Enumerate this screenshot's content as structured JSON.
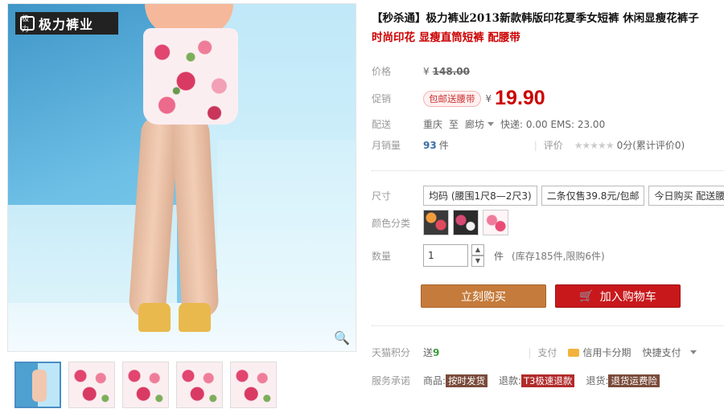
{
  "brand": {
    "logo_mark": "极力",
    "logo_text": "极力裤业"
  },
  "product": {
    "title": "【秒杀通】极力裤业2013新款韩版印花夏季女短裤 休闲显瘦花裤子",
    "subtitle": "时尚印花 显瘦直筒短裤 配腰带"
  },
  "price": {
    "label": "价格",
    "currency": "¥",
    "original": "148.00",
    "promo_label": "促销",
    "promo_badge": "包邮送腰带",
    "promo_price": "19.90"
  },
  "shipping": {
    "label": "配送",
    "from": "重庆",
    "to_word": "至",
    "to": "廊坊",
    "fees": "快递: 0.00 EMS: 23.00"
  },
  "sales": {
    "label": "月销量",
    "count": "93",
    "unit": "件",
    "rating_label": "评价",
    "stars": "★★★★★",
    "rating_text": "0分(累计评价0)"
  },
  "options": {
    "size_label": "尺寸",
    "sizes": [
      "均码 (腰围1尺8—2尺3)",
      "二条仅售39.8元/包邮",
      "今日购买 配送腰带"
    ],
    "color_label": "颜色分类",
    "qty_label": "数量",
    "qty_value": "1",
    "qty_unit": "件",
    "stock_text": "(库存185件,限购6件)",
    "step_up": "▲",
    "step_down": "▼"
  },
  "actions": {
    "buy": "立刻购买",
    "cart": "加入购物车",
    "cart_icon": "🛒"
  },
  "extras": {
    "points_label": "天猫积分",
    "points_prefix": "送",
    "points_value": "9",
    "pay_label": "支付",
    "pay_method": "信用卡分期",
    "pay_quick": "快捷支付",
    "service_label": "服务承诺",
    "goods_label": "商品:",
    "goods_tag": "按时发货",
    "refund_label": "退款:",
    "refund_tag": "T3极速退款",
    "return_label": "退货:",
    "return_tag": "退货运费险"
  },
  "icons": {
    "zoom": "🔍"
  },
  "colors": {
    "price_red": "#c00",
    "buy_button": "#c57b3b",
    "cart_button": "#c8181c"
  }
}
